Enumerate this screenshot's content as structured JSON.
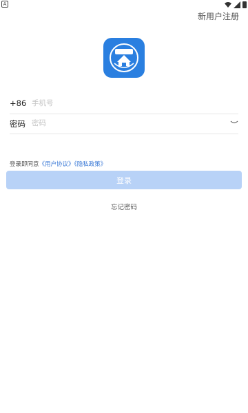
{
  "status_bar": {
    "left_badge": "A"
  },
  "header": {
    "register_label": "新用户注册"
  },
  "form": {
    "phone": {
      "label": "+86",
      "placeholder": "手机号"
    },
    "password": {
      "label": "密码",
      "placeholder": "密码"
    }
  },
  "agreement": {
    "prefix": "登录即同意",
    "user_agreement": "《用户协议》",
    "privacy_policy": "《隐私政策》"
  },
  "login_label": "登录",
  "forgot_label": "忘记密码",
  "colors": {
    "accent": "#2a7fe0",
    "button_disabled": "#b8d2f7",
    "link": "#3a79d6"
  },
  "icons": [
    "wifi-icon",
    "signal-icon",
    "battery-icon",
    "app-logo-icon",
    "eye-closed-icon"
  ]
}
